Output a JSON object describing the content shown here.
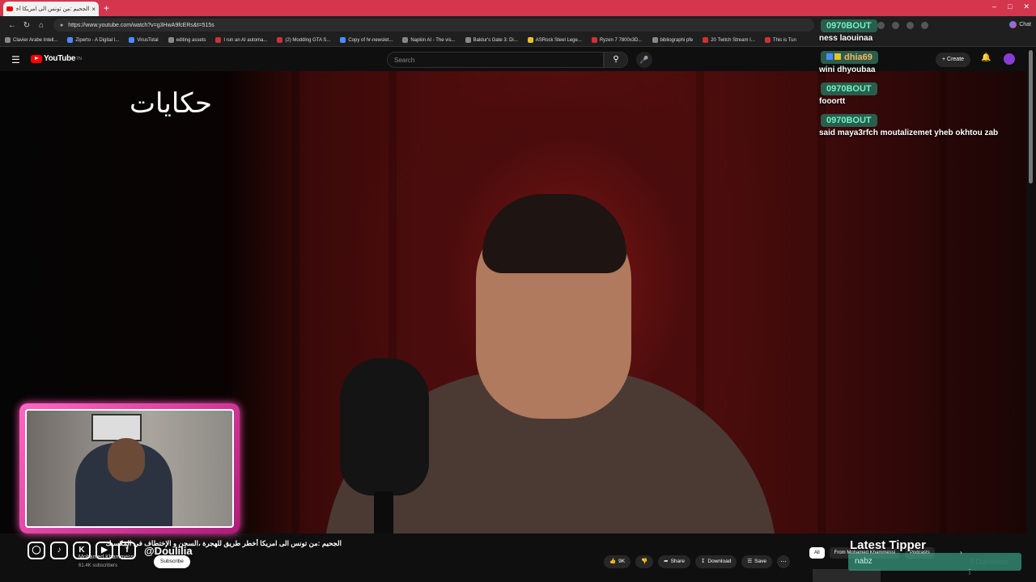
{
  "browser": {
    "tab_title": "الجحيم :من تونس الى امريكا أخطر طر",
    "close_tab": "×",
    "new_tab": "+",
    "url": "https://www.youtube.com/watch?v=g3HwA9fcERs&t=515s",
    "chat_label": "Chat",
    "bookmarks": [
      "Clavier Arabe Intell...",
      "Ziperto - A Digital I...",
      "VirusTotal",
      "editing assets",
      "I run an AI automa...",
      "(2) Modding GTA S...",
      "Copy of hr-newslet...",
      "Napkin AI - The vis...",
      "Baldur's Gate 3: Di...",
      "ASRock Steel Lege...",
      "Ryzen 7 7800x3D...",
      "bibliographi pfe",
      "20 Twitch Stream I...",
      "This is Tun"
    ]
  },
  "youtube": {
    "logo_text": "YouTube",
    "logo_sup": "TN",
    "search_placeholder": "Search",
    "create_label": "+ Create"
  },
  "video": {
    "overlay_logo": "حكايات"
  },
  "chat": [
    {
      "user": "0970BOUT",
      "text": "ness laouinaa"
    },
    {
      "user": "dhia69",
      "text": "wini dhyoubaa"
    },
    {
      "user": "0970BOUT",
      "text": "fooortt"
    },
    {
      "user": "0970BOUT",
      "text": "said maya3rfch moutalizemet yheb okhtou zab"
    }
  ],
  "overlay": {
    "social_handle": "@Doulilia",
    "latest_tipper_title": "Latest Tipper",
    "tipper_name": "nabz",
    "tipper_amount": "7 Diamonds"
  },
  "below_video": {
    "title": "الجحيم :من تونس الى امريكا أخطر طريق للهجرة ،السجن و الإختطاف في المكسيك",
    "channel": "Mohamed Khammessi",
    "subscribers": "61.4K subscribers",
    "subscribe_label": "Subscribe",
    "likes": "9K",
    "share_label": "Share",
    "download_label": "Download",
    "save_label": "Save"
  },
  "recommendations": {
    "chips": [
      "All",
      "From Mohamed Khammessi",
      "Podcasts"
    ]
  },
  "colors": {
    "tab_bar": "#d4364e",
    "chat_badge_bg": "#2b5d4d",
    "chat_badge_text": "#6ff3c6",
    "webcam_border": "#ff66c4"
  }
}
